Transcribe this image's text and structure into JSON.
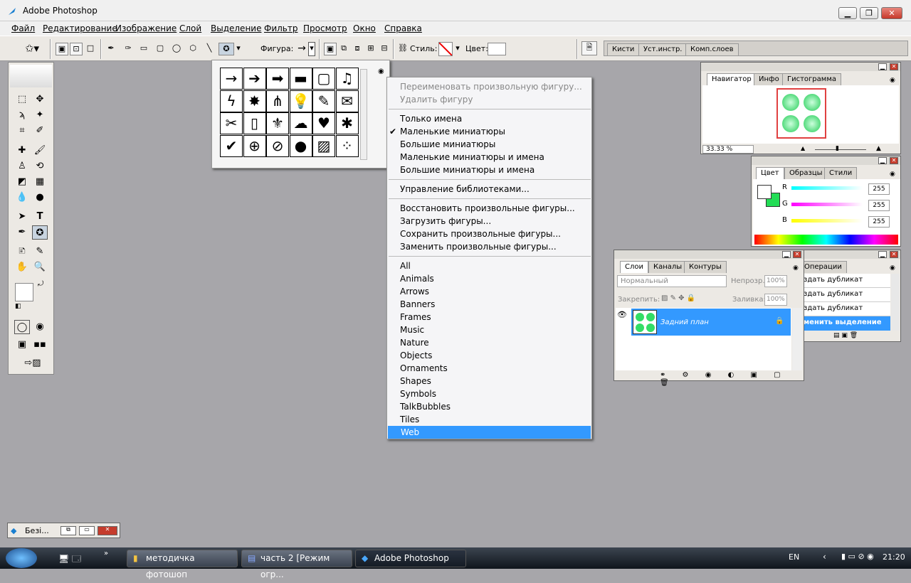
{
  "app": {
    "title": "Adobe Photoshop",
    "brand_color": "#1a7fd0"
  },
  "window_controls": {
    "minimize": "▁",
    "restore": "❐",
    "close": "✕"
  },
  "menu": [
    "Файл",
    "Редактирование",
    "Изображение",
    "Слой",
    "Выделение",
    "Фильтр",
    "Просмотр",
    "Окно",
    "Справка"
  ],
  "options": {
    "shape_label": "Фигура:",
    "style_label": "Стиль:",
    "color_label": "Цвет:",
    "color_value": "#ffffff"
  },
  "palette_well": {
    "tabs": [
      "Кисти",
      "Уст.инстр.",
      "Комп.слоев"
    ]
  },
  "shape_picker": {
    "shapes": [
      "arrow-thin",
      "arrow-bold",
      "arrow-block",
      "banner",
      "frame",
      "music-note",
      "lightning",
      "starburst",
      "grass",
      "lightbulb",
      "pin",
      "envelope",
      "scissors",
      "blank-page",
      "fleur-de-lis",
      "ink-blot",
      "heart",
      "puzzle",
      "checkmark",
      "target",
      "no-sign",
      "speech-bubble",
      "hatched-square",
      "diamond-grid"
    ],
    "glyphs": [
      "→",
      "➔",
      "➡",
      "▬",
      "▢",
      "♫",
      "ϟ",
      "✸",
      "⋔",
      "💡",
      "✎",
      "✉",
      "✂",
      "▯",
      "⚜",
      "☁",
      "♥",
      "✱",
      "✔",
      "⊕",
      "⊘",
      "●",
      "▨",
      "⁘"
    ]
  },
  "context_menu": {
    "items": [
      {
        "label": "Переименовать произвольную фигуру...",
        "disabled": true
      },
      {
        "label": "Удалить фигуру",
        "disabled": true
      },
      {
        "sep": true
      },
      {
        "label": "Только имена"
      },
      {
        "label": "Маленькие миниатюры",
        "checked": true
      },
      {
        "label": "Большие миниатюры"
      },
      {
        "label": "Маленькие миниатюры и имена"
      },
      {
        "label": "Большие миниатюры и имена"
      },
      {
        "sep": true
      },
      {
        "label": "Управление библиотеками..."
      },
      {
        "sep": true
      },
      {
        "label": "Восстановить произвольные фигуры..."
      },
      {
        "label": "Загрузить фигуры..."
      },
      {
        "label": "Сохранить произвольные фигуры..."
      },
      {
        "label": "Заменить произвольные фигуры..."
      },
      {
        "sep": true
      },
      {
        "label": "All"
      },
      {
        "label": "Animals"
      },
      {
        "label": "Arrows"
      },
      {
        "label": "Banners"
      },
      {
        "label": "Frames"
      },
      {
        "label": "Music"
      },
      {
        "label": "Nature"
      },
      {
        "label": "Objects"
      },
      {
        "label": "Ornaments"
      },
      {
        "label": "Shapes"
      },
      {
        "label": "Symbols"
      },
      {
        "label": "TalkBubbles"
      },
      {
        "label": "Tiles"
      },
      {
        "label": "Web",
        "selected": true
      }
    ],
    "check_glyph": "✔"
  },
  "navigator": {
    "tabs": [
      "Навигатор",
      "Инфо",
      "Гистограмма"
    ],
    "zoom": "33.33 %"
  },
  "color_panel": {
    "tabs": [
      "Цвет",
      "Образцы",
      "Стили"
    ],
    "channels": [
      {
        "name": "R",
        "value": "255"
      },
      {
        "name": "G",
        "value": "255"
      },
      {
        "name": "B",
        "value": "255"
      }
    ],
    "fg": "#ffffff",
    "bg": "#22dd55"
  },
  "layers": {
    "tabs": [
      "Слои",
      "Каналы",
      "Контуры"
    ],
    "blend_mode": "Нормальный",
    "opacity_label": "Непрозр.:",
    "opacity": "100%",
    "lock_label": "Закрепить:",
    "fill_label": "Заливка:",
    "fill": "100%",
    "layer_name": "Задний план"
  },
  "actions": {
    "tab": "Операции",
    "items": [
      "здать дубликат",
      "здать дубликат",
      "здать дубликат",
      "менить выделение"
    ]
  },
  "minimized_doc": {
    "label": "Безі..."
  },
  "taskbar": {
    "buttons": [
      "методичка фотошоп",
      "часть 2 [Режим огр...",
      "Adobe Photoshop"
    ],
    "lang": "EN",
    "time": "21:20"
  }
}
